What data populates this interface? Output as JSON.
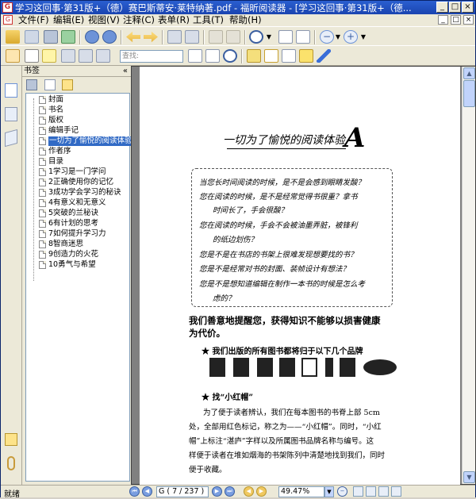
{
  "titlebar": {
    "title": "学习这回事·第31版+（德）赛巴斯蒂安·莱特纳著.pdf - 福昕阅读器 - [学习这回事·第31版+（德...",
    "app_icon": "foxit-icon"
  },
  "menubar": {
    "items": [
      "文件(F)",
      "编辑(E)",
      "视图(V)",
      "注释(C)",
      "表单(R)",
      "工具(T)",
      "帮助(H)"
    ]
  },
  "toolbar": {
    "search_placeholder": "查找:"
  },
  "bookmarks": {
    "header": "书签",
    "collapse_glyph": "«",
    "items": [
      {
        "label": "封面",
        "selected": false
      },
      {
        "label": "书名",
        "selected": false
      },
      {
        "label": "版权",
        "selected": false
      },
      {
        "label": "编辑手记",
        "selected": false
      },
      {
        "label": "一切为了愉悦的阅读体验",
        "selected": true
      },
      {
        "label": "作者序",
        "selected": false
      },
      {
        "label": "目录",
        "selected": false
      },
      {
        "label": "1学习是一门学问",
        "selected": false
      },
      {
        "label": "2正确使用你的记忆",
        "selected": false
      },
      {
        "label": "3成功学会学习的秘诀",
        "selected": false
      },
      {
        "label": "4有意义和无意义",
        "selected": false
      },
      {
        "label": "5突破的兰秘诀",
        "selected": false
      },
      {
        "label": "6有计划的思考",
        "selected": false
      },
      {
        "label": "7如何提升学习力",
        "selected": false
      },
      {
        "label": "8智商迷思",
        "selected": false
      },
      {
        "label": "9创造力的火花",
        "selected": false
      },
      {
        "label": "10勇气与希望",
        "selected": false
      }
    ]
  },
  "page": {
    "headline": "一切为了愉悦的阅读体验",
    "big_letter": "A",
    "questions": [
      "当您长时间阅读的时候，是不是会感到眼睛发酸？",
      "您在阅读的时候，是不是经常觉得书很重？拿书",
      "时间长了，手会很酸？",
      "您在阅读的时候，手会不会被油墨弄脏，被锋利",
      "的纸边划伤？",
      "您是不是在书店的书架上很难发现想要找的书？",
      "您是不是经常对书的封面、装帧设计有想法？",
      "您是不是想知道编辑在制作一本书的时候是怎么考",
      "虑的？"
    ],
    "bold_para_1": "我们善意地提醒您，获得知识不能够以损害健康",
    "bold_para_2": "为代价。",
    "brands_heading": "★ 我们出版的所有图书都将归于以下几个品牌",
    "section_heading": "★ 找“小红帽”",
    "body_lines": [
      "为了便于读者辨认，我们在每本图书的书脊上部 5cm",
      "处，全部用红色标记，称之为——“小红帽”。同时，“小红",
      "帽”上标注“湛庐”字样以及所属图书品牌名称与编号。这",
      "样便于读者在堆如烟海的书架陈列中清楚地找到我们，同时",
      "便于收藏。"
    ]
  },
  "statusbar": {
    "status": "就绪",
    "page_field": "G ( 7 / 237 )",
    "zoom": "49.47%"
  }
}
